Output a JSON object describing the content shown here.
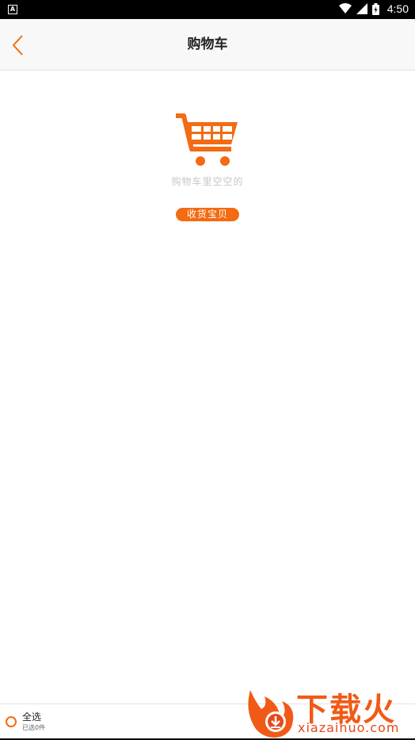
{
  "status_bar": {
    "time": "4:50",
    "app_badge": "A"
  },
  "header": {
    "title": "购物车"
  },
  "empty_state": {
    "message": "购物车里空空的",
    "button_label": "收货宝贝"
  },
  "bottom_bar": {
    "select_all_label": "全选",
    "selected_count_text": "已选0件"
  },
  "watermark": {
    "logo_text": "下载火",
    "url_text": "xiazaihuo.com"
  },
  "colors": {
    "accent": "#f36b12",
    "header_bg": "#f8f8f8",
    "status_bar_bg": "#000000"
  }
}
